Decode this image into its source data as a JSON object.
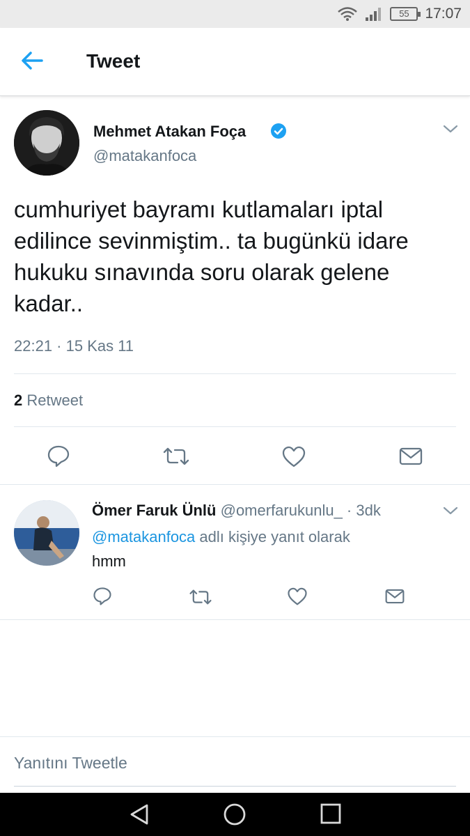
{
  "status_bar": {
    "time": "17:07",
    "battery": "55",
    "icons": [
      "wifi-icon",
      "signal-icon",
      "battery-icon"
    ]
  },
  "header": {
    "title": "Tweet",
    "back_icon": "arrow-left-icon",
    "accent_color": "#1da1f2"
  },
  "tweet": {
    "author_name": "Mehmet Atakan Foça",
    "handle": "@matakanfoca",
    "verified": true,
    "text": "cumhuriyet bayramı kutlamaları iptal edilince sevinmiştim.. ta bugünkü idare hukuku sınavında soru olarak gelene kadar..",
    "timestamp": "22:21 · 15 Kas 11",
    "retweet_count": "2",
    "retweet_label": "Retweet",
    "actions": [
      "reply-icon",
      "retweet-icon",
      "like-icon",
      "message-icon"
    ]
  },
  "reply": {
    "author_name": "Ömer Faruk Ünlü",
    "meta": "@omerfarukunlu_ · 3dk",
    "mention": "@matakanfoca",
    "context_suffix": "adlı kişiye yanıt olarak",
    "text": "hmm",
    "actions": [
      "reply-icon",
      "retweet-icon",
      "like-icon",
      "message-icon"
    ]
  },
  "compose": {
    "placeholder": "Yanıtını Tweetle"
  },
  "nav_bar": {
    "buttons": [
      "back-triangle-icon",
      "home-circle-icon",
      "recents-square-icon"
    ]
  }
}
